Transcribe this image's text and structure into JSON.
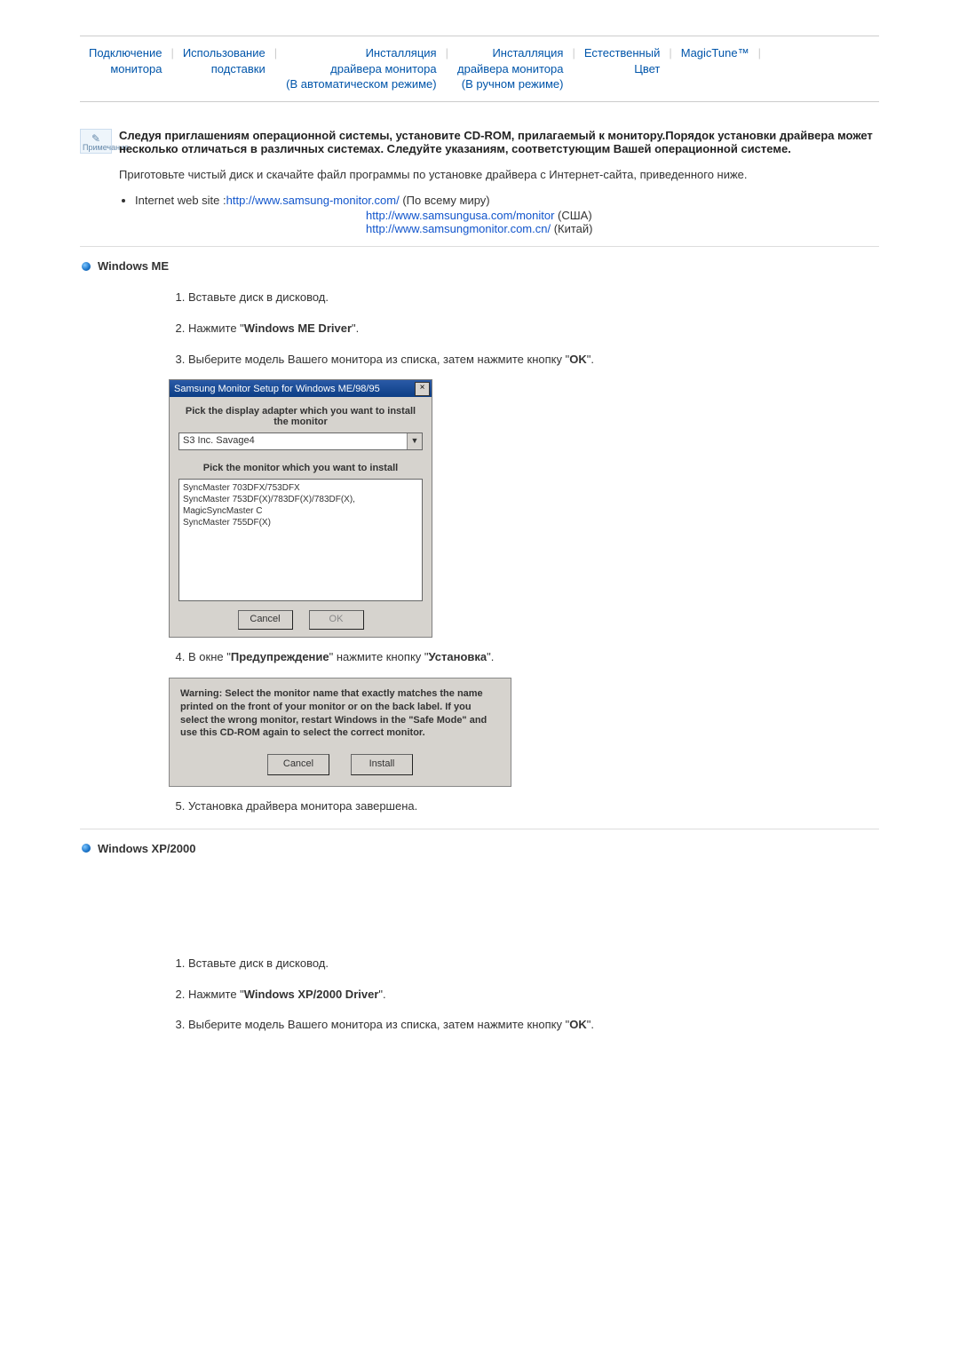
{
  "tabs": [
    "Подключение монитора",
    "Использование подставки",
    "Инсталляция драйвера монитора (В автоматическом режиме)",
    "Инсталляция драйвера монитора (В ручном режиме)",
    "Естественный Цвет",
    "MagicTune™"
  ],
  "note_icon_label": "Примечание",
  "note_bold": "Следуя приглашениям операционной системы, установите CD-ROM, прилагаемый к монитору.Порядок установки драйвера может несколько отличаться в различных системах. Следуйте указаниям, соответстующим Вашей операционной системе.",
  "prep_text": "Приготовьте чистый диск и скачайте файл программы по установке драйвера с Интернет-сайта, приведенного ниже.",
  "internet_label": "Internet web site :",
  "links": [
    {
      "url": "http://www.samsung-monitor.com/",
      "suffix": " (По всему миру)"
    },
    {
      "url": "http://www.samsungusa.com/monitor",
      "suffix": " (США)"
    },
    {
      "url": "http://www.samsungmonitor.com.cn/",
      "suffix": " (Китай)"
    }
  ],
  "sections": {
    "me": {
      "title": "Windows ME",
      "steps": [
        "Вставьте диск в дисковод.",
        "Нажмите \"Windows ME Driver\".",
        "Выберите модель Вашего монитора из списка, затем нажмите кнопку \"OK\".",
        "В окне \"Предупреждение\" нажмите кнопку \"Установка\".",
        "Установка драйвера монитора завершена."
      ],
      "step2_bold": "Windows ME Driver",
      "step3_bold": "OK",
      "step4_bold1": "Предупреждение",
      "step4_bold2": "Установка"
    },
    "xp": {
      "title": "Windows XP/2000",
      "steps": [
        "Вставьте диск в дисковод.",
        "Нажмите \"Windows XP/2000 Driver\".",
        "Выберите модель Вашего монитора из списка, затем нажмите кнопку \"OK\"."
      ],
      "step2_bold": "Windows XP/2000 Driver",
      "step3_bold": "OK"
    }
  },
  "dialog_me": {
    "title": "Samsung Monitor Setup for Windows ME/98/95",
    "label1": "Pick the display adapter which you want to install the monitor",
    "combo_value": "S3 Inc. Savage4",
    "label2": "Pick the monitor which you want to install",
    "list": [
      "SyncMaster 703DFX/753DFX",
      "SyncMaster 753DF(X)/783DF(X)/783DF(X), MagicSyncMaster C",
      "SyncMaster 755DF(X)"
    ],
    "cancel": "Cancel",
    "ok": "OK"
  },
  "dialog_warn": {
    "text": "Warning: Select the monitor name that exactly matches the name printed on the front of your monitor or on the back label. If you select the wrong monitor, restart Windows in the \"Safe Mode\" and use this CD-ROM again to select the correct monitor.",
    "cancel": "Cancel",
    "install": "Install"
  }
}
